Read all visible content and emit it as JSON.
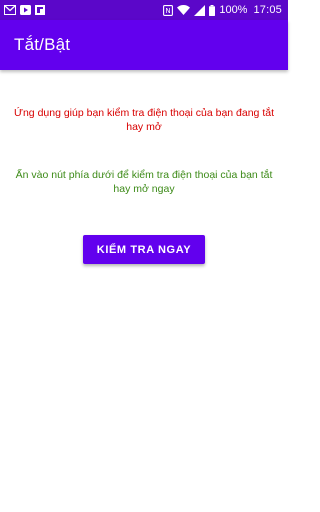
{
  "status_bar": {
    "left_icons": [
      "gmail-icon",
      "video-play-icon",
      "flipboard-icon"
    ],
    "right_icons": [
      "nfc-icon",
      "wifi-icon",
      "signal-icon"
    ],
    "battery_percent": "100%",
    "time": "17:05"
  },
  "app_bar": {
    "title": "Tắt/Bật"
  },
  "main": {
    "description_red": "Ứng dụng giúp bạn kiểm tra điện thoại của bạn đang tắt hay mở",
    "description_green": "Ấn vào nút phía dưới để kiểm tra điện thoại của bạn tắt hay mở ngay",
    "button_label": "KIỂM TRA NGAY"
  },
  "colors": {
    "status_bar": "#5b07c9",
    "app_bar": "#6200ee",
    "button": "#6200ee",
    "text_red": "#d80000",
    "text_green": "#3c8a17"
  }
}
